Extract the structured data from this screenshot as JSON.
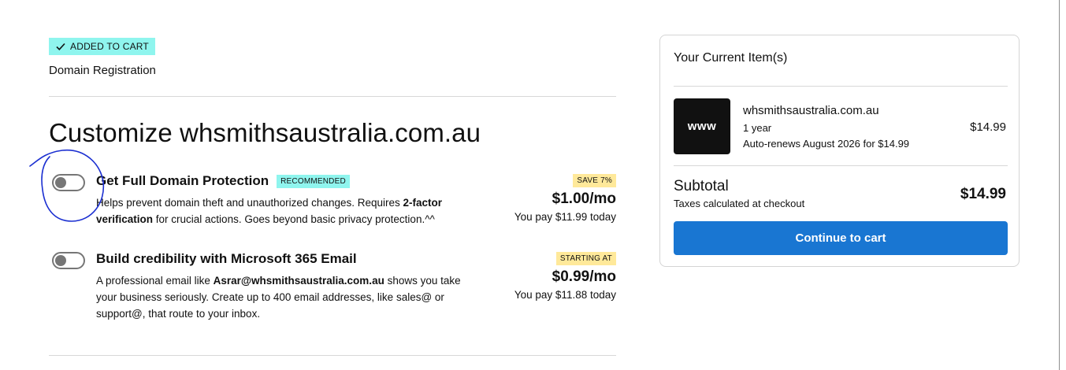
{
  "cart_badge": {
    "icon": "checkmark-icon",
    "label": "ADDED TO CART"
  },
  "product_type": "Domain Registration",
  "heading": "Customize whsmithsaustralia.com.au",
  "offers": [
    {
      "enabled": false,
      "title": "Get Full Domain Protection",
      "tag": "RECOMMENDED",
      "desc_parts": [
        "Helps prevent domain theft and unauthorized changes. Requires ",
        "2-factor verification",
        " for crucial actions. Goes beyond basic privacy protection.^^"
      ],
      "price_tag": "SAVE 7%",
      "price": "$1.00/mo",
      "pay": "You pay $11.99 today"
    },
    {
      "enabled": false,
      "title": "Build credibility with Microsoft 365 Email",
      "desc_parts": [
        "A professional email like ",
        "Asrar@whsmithsaustralia.com.au",
        " shows you take your business seriously. Create up to 400 email addresses, like sales@ or support@, that route to your inbox."
      ],
      "price_tag": "STARTING AT",
      "price": "$0.99/mo",
      "pay": "You pay $11.88 today"
    }
  ],
  "summary": {
    "title": "Your Current Item(s)",
    "item": {
      "thumb": "www",
      "domain": "whsmithsaustralia.com.au",
      "term": "1 year",
      "renewal": "Auto-renews August 2026 for $14.99",
      "price": "$14.99"
    },
    "subtotal_label": "Subtotal",
    "tax_note": "Taxes calculated at checkout",
    "subtotal_value": "$14.99",
    "cta": "Continue to cart"
  },
  "colors": {
    "accent_cyan": "#8ff5ee",
    "save_yellow": "#ffe99a",
    "cta_blue": "#1976d2",
    "annotation_blue": "#1b2fd1"
  }
}
